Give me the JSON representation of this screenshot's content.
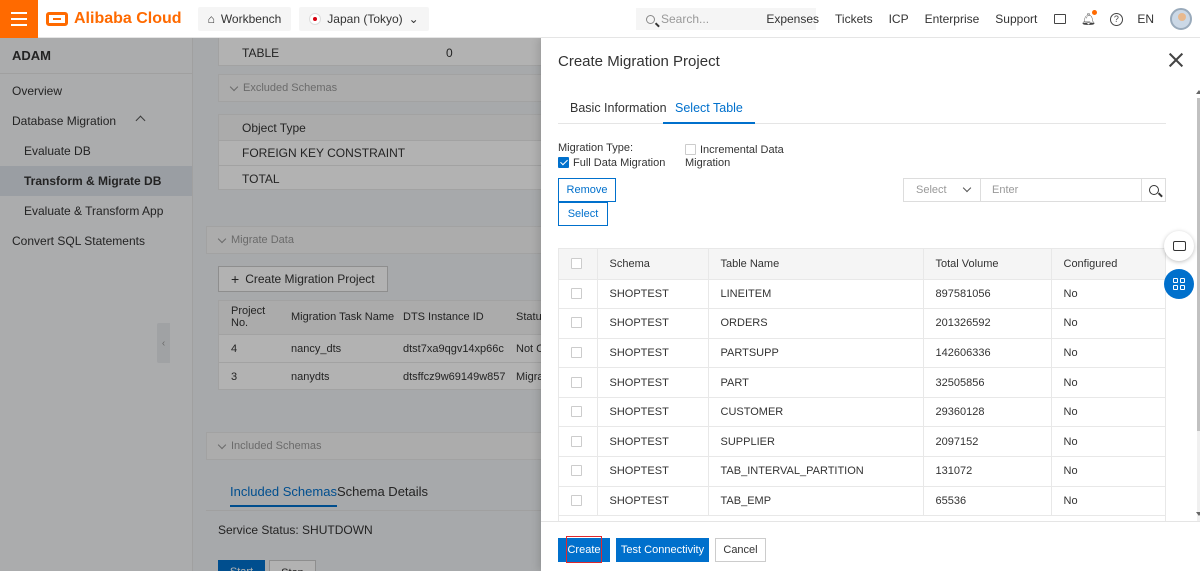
{
  "topbar": {
    "brand": "Alibaba Cloud",
    "workbench": "Workbench",
    "region": "Japan (Tokyo)",
    "search_placeholder": "Search...",
    "links": [
      "Expenses",
      "Tickets",
      "ICP",
      "Enterprise",
      "Support"
    ],
    "lang": "EN"
  },
  "sidebar": {
    "title": "ADAM",
    "items": [
      {
        "label": "Overview"
      },
      {
        "label": "Database Migration"
      },
      {
        "label": "Evaluate DB"
      },
      {
        "label": "Transform & Migrate DB"
      },
      {
        "label": "Evaluate & Transform App"
      },
      {
        "label": "Convert SQL Statements"
      }
    ]
  },
  "background": {
    "table_label": "TABLE",
    "table_value": "0",
    "excluded_schemas": "Excluded Schemas",
    "object_type": "Object Type",
    "fk_constraint": "FOREIGN KEY CONSTRAINT",
    "total": "TOTAL",
    "migrate_data": "Migrate Data",
    "create_project": "Create Migration Project",
    "grid_headers": [
      "Project No.",
      "Migration Task Name",
      "DTS Instance ID",
      "Status"
    ],
    "grid_rows": [
      [
        "4",
        "nancy_dts",
        "dtst7xa9qgv14xp66c",
        "Not C"
      ],
      [
        "3",
        "nanydts",
        "dtsffcz9w69149w857",
        "Migra"
      ]
    ],
    "included_schemas_hdr": "Included Schemas",
    "tab_included": "Included Schemas",
    "tab_details": "Schema Details",
    "service_status": "Service Status: SHUTDOWN",
    "start": "Start",
    "stop": "Stop"
  },
  "drawer": {
    "title": "Create Migration Project",
    "tabs": [
      "Basic Information",
      "Select Table"
    ],
    "migration_type_label": "Migration Type:",
    "full_data": "Full Data Migration",
    "incremental_line1": "Incremental Data",
    "incremental_line2": "Migration",
    "remove": "Remove",
    "select": "Select",
    "filter_select": "Select",
    "filter_placeholder": "Enter",
    "columns": [
      "Schema",
      "Table Name",
      "Total Volume",
      "Configured"
    ],
    "rows": [
      [
        "SHOPTEST",
        "LINEITEM",
        "897581056",
        "No"
      ],
      [
        "SHOPTEST",
        "ORDERS",
        "201326592",
        "No"
      ],
      [
        "SHOPTEST",
        "PARTSUPP",
        "142606336",
        "No"
      ],
      [
        "SHOPTEST",
        "PART",
        "32505856",
        "No"
      ],
      [
        "SHOPTEST",
        "CUSTOMER",
        "29360128",
        "No"
      ],
      [
        "SHOPTEST",
        "SUPPLIER",
        "2097152",
        "No"
      ],
      [
        "SHOPTEST",
        "TAB_INTERVAL_PARTITION",
        "131072",
        "No"
      ],
      [
        "SHOPTEST",
        "TAB_EMP",
        "65536",
        "No"
      ]
    ],
    "create": "Create",
    "test": "Test Connectivity",
    "cancel": "Cancel"
  },
  "colors": {
    "brand": "#ff6a00",
    "primary": "#0070cc",
    "highlight": "#e0282c"
  }
}
